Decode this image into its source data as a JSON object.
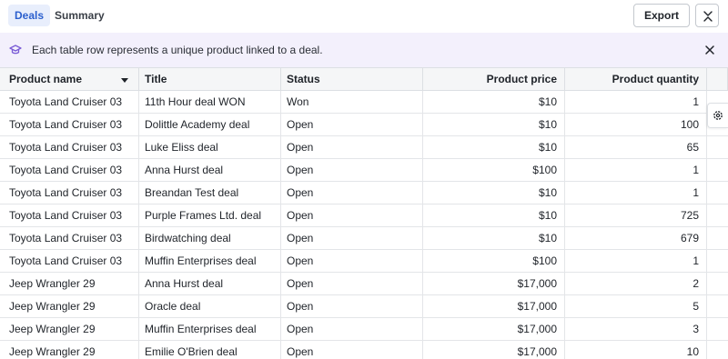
{
  "tabs": {
    "deals": "Deals",
    "summary": "Summary"
  },
  "toolbar": {
    "export_label": "Export"
  },
  "banner": {
    "text": "Each table row represents a unique product linked to a deal."
  },
  "table": {
    "columns": [
      "Product name",
      "Title",
      "Status",
      "Product price",
      "Product quantity"
    ],
    "rows": [
      [
        "Toyota Land Cruiser 03",
        "11th Hour deal WON",
        "Won",
        "$10",
        "1"
      ],
      [
        "Toyota Land Cruiser 03",
        "Dolittle Academy deal",
        "Open",
        "$10",
        "100"
      ],
      [
        "Toyota Land Cruiser 03",
        "Luke Eliss deal",
        "Open",
        "$10",
        "65"
      ],
      [
        "Toyota Land Cruiser 03",
        "Anna Hurst deal",
        "Open",
        "$100",
        "1"
      ],
      [
        "Toyota Land Cruiser 03",
        "Breandan Test deal",
        "Open",
        "$10",
        "1"
      ],
      [
        "Toyota Land Cruiser 03",
        "Purple Frames Ltd. deal",
        "Open",
        "$10",
        "725"
      ],
      [
        "Toyota Land Cruiser 03",
        "Birdwatching deal",
        "Open",
        "$10",
        "679"
      ],
      [
        "Toyota Land Cruiser 03",
        "Muffin Enterprises deal",
        "Open",
        "$100",
        "1"
      ],
      [
        "Jeep Wrangler 29",
        "Anna Hurst deal",
        "Open",
        "$17,000",
        "2"
      ],
      [
        "Jeep Wrangler 29",
        "Oracle deal",
        "Open",
        "$17,000",
        "5"
      ],
      [
        "Jeep Wrangler 29",
        "Muffin Enterprises deal",
        "Open",
        "$17,000",
        "3"
      ],
      [
        "Jeep Wrangler 29",
        "Emilie O'Brien deal",
        "Open",
        "$17,000",
        "10"
      ]
    ]
  },
  "colors": {
    "accent": "#2b5fce",
    "tab_active_bg": "#e8eefc",
    "banner_bg": "#f3f0fc",
    "banner_icon": "#7a5bd6"
  },
  "icons": {
    "banner": "graduation-cap-icon",
    "banner_close": "close-icon",
    "collapse": "collapse-icon",
    "settings": "gear-icon",
    "sort": "caret-down-icon"
  }
}
